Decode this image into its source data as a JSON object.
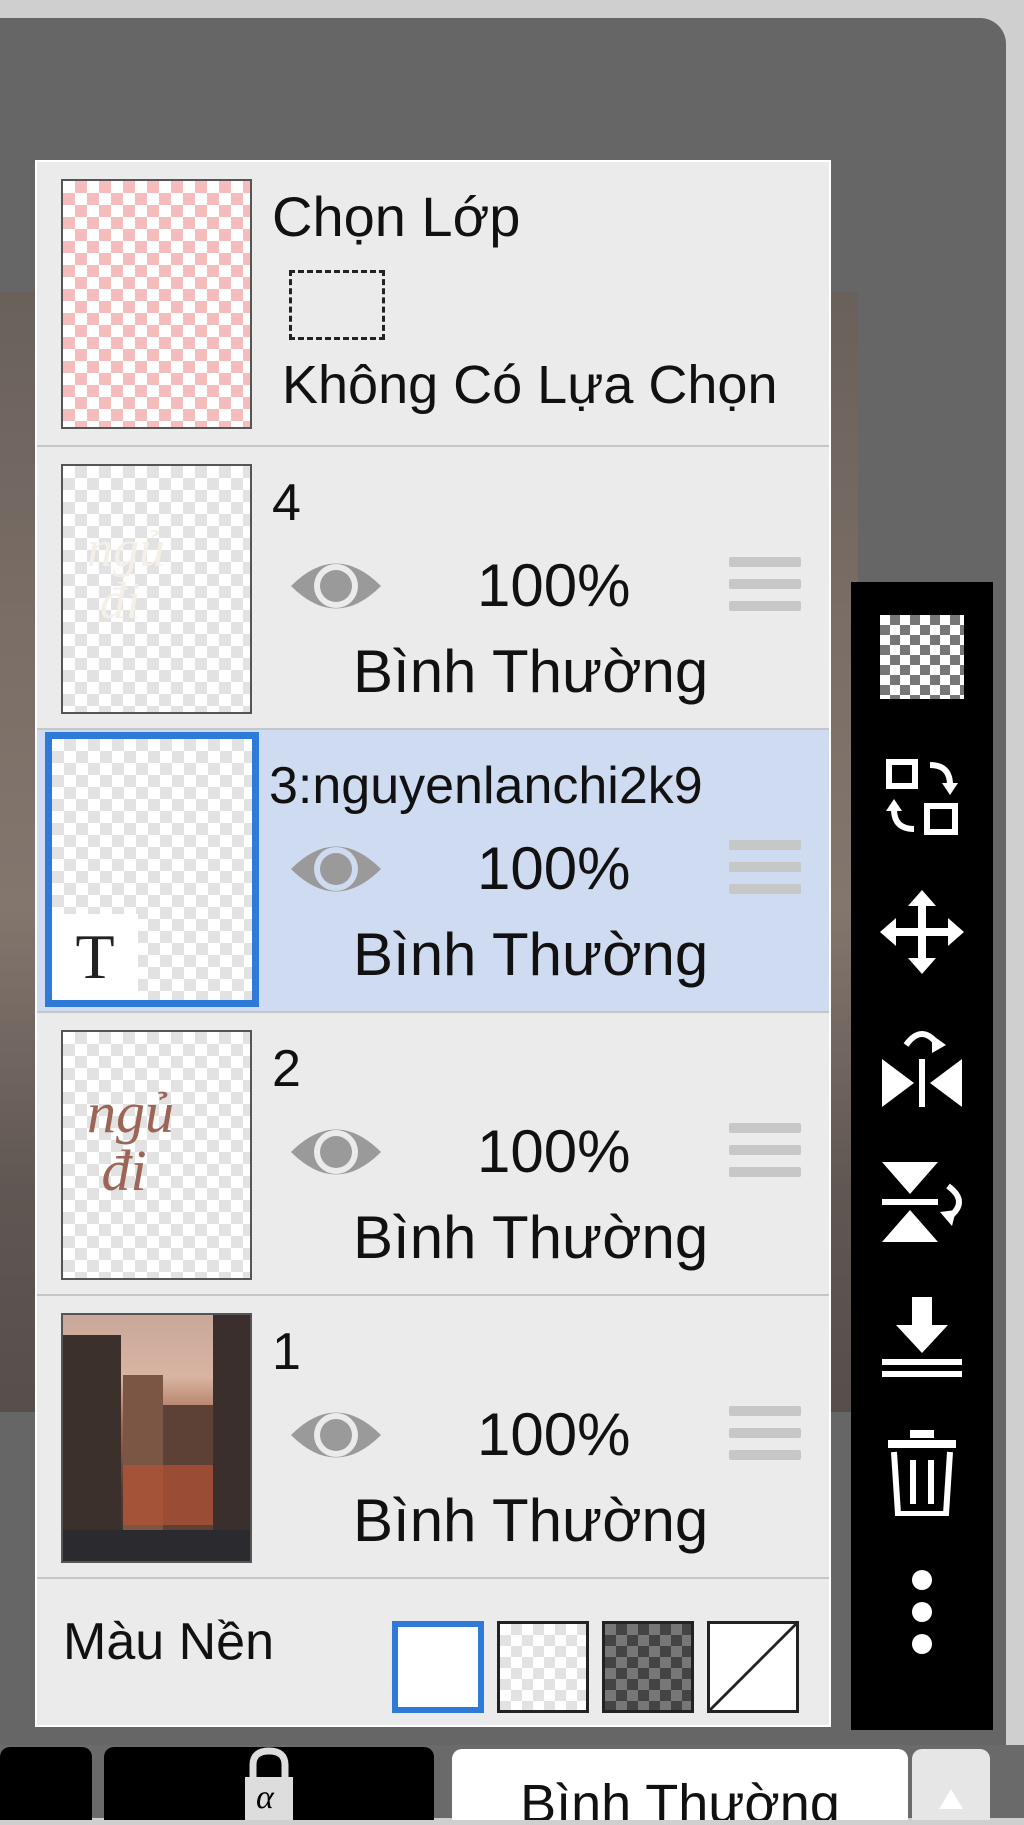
{
  "selection_row": {
    "title": "Chọn Lớp",
    "subtitle": "Không Có Lựa Chọn"
  },
  "layers": [
    {
      "name": "4",
      "opacity": "100%",
      "blend": "Bình Thường",
      "visible": true,
      "selected": false,
      "thumb_text": "ngủ đi"
    },
    {
      "name": "3:nguyenlanchi2k9",
      "opacity": "100%",
      "blend": "Bình Thường",
      "visible": true,
      "selected": true,
      "badge": "T"
    },
    {
      "name": "2",
      "opacity": "100%",
      "blend": "Bình Thường",
      "visible": true,
      "selected": false,
      "thumb_text": "ngủ đi"
    },
    {
      "name": "1",
      "opacity": "100%",
      "blend": "Bình Thường",
      "visible": true,
      "selected": false
    }
  ],
  "background_color": {
    "label": "Màu Nền",
    "options": [
      "white",
      "transparent",
      "dark-checker",
      "none"
    ],
    "selected": "white"
  },
  "toolbar": {
    "icons": [
      "transparency-icon",
      "swap-layer-icon",
      "move-icon",
      "flip-horizontal-icon",
      "flip-vertical-icon",
      "merge-down-icon",
      "delete-icon",
      "more-icon"
    ]
  },
  "bottom_bar": {
    "lock_symbol": "α",
    "blend_mode": "Bình Thường"
  },
  "colors": {
    "accent": "#2f7ad6",
    "selected_row": "#cfdbf0",
    "panel": "#ebebeb"
  }
}
